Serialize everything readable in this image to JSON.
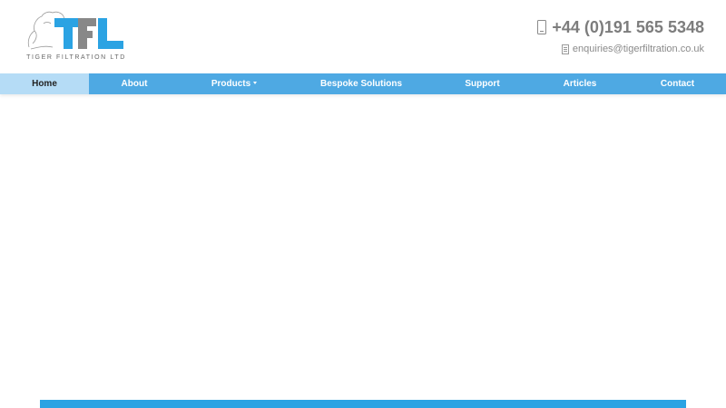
{
  "brand": {
    "logo_letters": "TFL",
    "caption": "TIGER FILTRATION LTD",
    "colors": {
      "blue": "#2ba3e3",
      "grey": "#888888"
    }
  },
  "contact": {
    "phone": "+44 (0)191 565 5348",
    "email": "enquiries@tigerfiltration.co.uk"
  },
  "nav": {
    "items": [
      {
        "label": "Home"
      },
      {
        "label": "About"
      },
      {
        "label": "Products"
      },
      {
        "label": "Bespoke Solutions"
      },
      {
        "label": "Support"
      },
      {
        "label": "Articles"
      },
      {
        "label": "Contact"
      }
    ],
    "active": "Home"
  },
  "theme": {
    "nav_bg": "#4ea9e3",
    "nav_active_bg": "#b5dcf6",
    "footer_bar": "#2ba3e3"
  }
}
